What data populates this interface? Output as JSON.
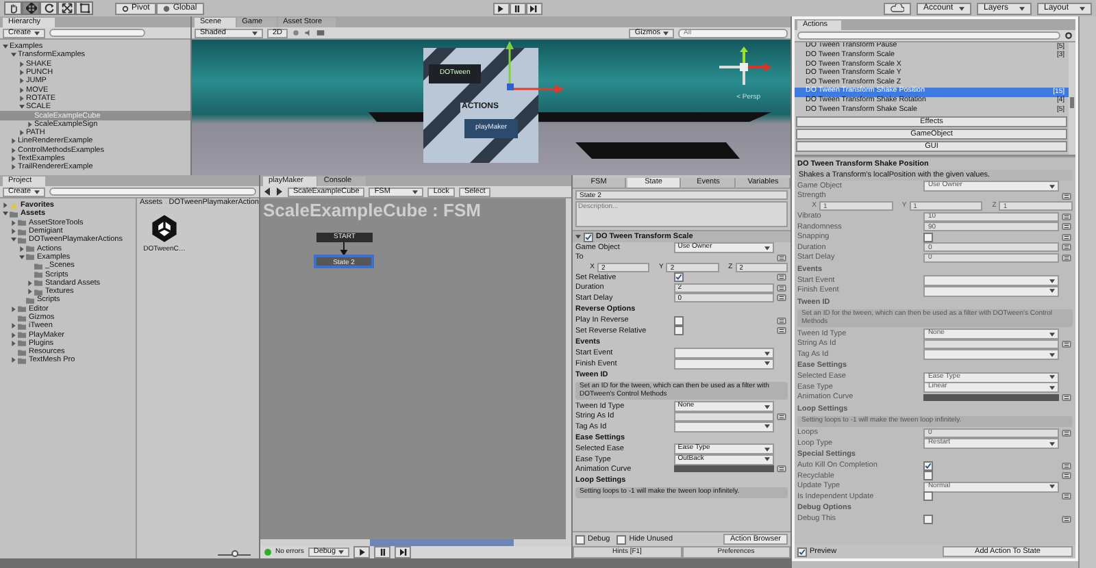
{
  "toolbar": {
    "tools": [
      {
        "kind": "hand",
        "selected": false
      },
      {
        "kind": "move",
        "selected": true
      },
      {
        "kind": "rotate",
        "selected": false
      },
      {
        "kind": "scale",
        "selected": false
      },
      {
        "kind": "rect",
        "selected": false
      }
    ],
    "pivot": "Pivot",
    "global": "Global",
    "account": "Account",
    "layers": "Layers",
    "layout": "Layout"
  },
  "hierarchy": {
    "tab": "Hierarchy",
    "create": "Create",
    "items": [
      {
        "label": "Examples",
        "expanded": true,
        "selected": false,
        "children": [
          {
            "label": "TransformExamples",
            "expanded": true,
            "selected": false,
            "children": [
              {
                "label": "SHAKE",
                "expanded": false,
                "selected": false
              },
              {
                "label": "PUNCH",
                "expanded": false,
                "selected": false
              },
              {
                "label": "JUMP",
                "expanded": false,
                "selected": false
              },
              {
                "label": "MOVE",
                "expanded": false,
                "selected": false
              },
              {
                "label": "ROTATE",
                "expanded": false,
                "selected": false
              },
              {
                "label": "SCALE",
                "expanded": true,
                "selected": false,
                "children": [
                  {
                    "label": "ScaleExampleCube",
                    "selected": true
                  },
                  {
                    "label": "ScaleExampleSign",
                    "expanded": false,
                    "selected": false
                  }
                ]
              },
              {
                "label": "PATH",
                "expanded": false,
                "selected": false
              }
            ]
          },
          {
            "label": "LineRendererExample",
            "expanded": false,
            "selected": false
          },
          {
            "label": "ControlMethodsExamples",
            "expanded": false,
            "selected": false
          },
          {
            "label": "TextExamples",
            "expanded": false,
            "selected": false
          },
          {
            "label": "TrailRendererExample",
            "expanded": false,
            "selected": false
          }
        ]
      }
    ]
  },
  "scene": {
    "tabs": [
      {
        "label": "Scene",
        "selected": true
      },
      {
        "label": "Game",
        "selected": false
      },
      {
        "label": "Asset Store",
        "selected": false
      }
    ],
    "shading": "Shaded",
    "mode_2d": "2D",
    "gizmos": "Gizmos",
    "search_placeholder": "All",
    "projection": "< Persp",
    "card": {
      "top_logo": "DOTween",
      "middle": "ACTIONS",
      "bottom_logo": "playMaker"
    }
  },
  "project": {
    "tab": "Project",
    "create": "Create",
    "items": [
      {
        "label": "Favorites",
        "kind": "favorites",
        "expanded": false,
        "selected": false
      },
      {
        "label": "Assets",
        "kind": "folder",
        "expanded": true,
        "selected": false,
        "children": [
          {
            "label": "AssetStoreTools",
            "expanded": false,
            "selected": false
          },
          {
            "label": "Demigiant",
            "expanded": false,
            "selected": false
          },
          {
            "label": "DOTweenPlaymakerActions",
            "expanded": true,
            "selected": false,
            "children": [
              {
                "label": "Actions",
                "expanded": false,
                "selected": false
              },
              {
                "label": "Examples",
                "expanded": true,
                "selected": false,
                "children": [
                  {
                    "label": "_Scenes",
                    "selected": false
                  },
                  {
                    "label": "Scripts",
                    "selected": false
                  },
                  {
                    "label": "Standard Assets",
                    "expanded": false,
                    "selected": false
                  },
                  {
                    "label": "Textures",
                    "expanded": false,
                    "selected": false
                  }
                ]
              },
              {
                "label": "Scripts",
                "selected": false
              }
            ]
          },
          {
            "label": "Editor",
            "expanded": false,
            "selected": false
          },
          {
            "label": "Gizmos",
            "selected": false
          },
          {
            "label": "iTween",
            "expanded": false,
            "selected": false
          },
          {
            "label": "PlayMaker",
            "expanded": false,
            "selected": false
          },
          {
            "label": "Plugins",
            "expanded": false,
            "selected": false
          },
          {
            "label": "Resources",
            "selected": false
          },
          {
            "label": "TextMesh Pro",
            "expanded": false,
            "selected": false
          }
        ]
      }
    ],
    "breadcrumb": [
      "Assets",
      "DOTweenPlaymakerAction"
    ],
    "assets": [
      "DOTweenC…"
    ],
    "zoom": {
      "level": 0.5
    }
  },
  "playmaker": {
    "tabs": [
      {
        "label": "playMaker",
        "selected": true
      },
      {
        "label": "Console",
        "selected": false
      }
    ],
    "object": "ScaleExampleCube",
    "fsm": "FSM",
    "lock": "Lock",
    "select": "Select",
    "title": "ScaleExampleCube : FSM",
    "start_label": "START",
    "states": [
      {
        "label": "State 2",
        "selected": true
      }
    ],
    "status": "No errors",
    "debug": "Debug"
  },
  "fsm_inspector": {
    "tabs": [
      {
        "label": "FSM",
        "selected": false
      },
      {
        "label": "State",
        "selected": true
      },
      {
        "label": "Events",
        "selected": false
      },
      {
        "label": "Variables",
        "selected": false
      }
    ],
    "state_name": "State 2",
    "description_placeholder": "Description...",
    "action": {
      "title": "DO Tween Transform Scale",
      "enabled": true
    },
    "rows": [
      {
        "kind": "dropdown",
        "label": "Game Object",
        "value": "Use Owner"
      },
      {
        "kind": "label",
        "label": "To"
      },
      {
        "kind": "vector",
        "axes": [
          {
            "axis": "X",
            "value": "2"
          },
          {
            "axis": "Y",
            "value": "2"
          },
          {
            "axis": "Z",
            "value": "2"
          }
        ]
      },
      {
        "kind": "checkbox",
        "label": "Set Relative",
        "checked": true
      },
      {
        "kind": "field",
        "label": "Duration",
        "value": "2"
      },
      {
        "kind": "field",
        "label": "Start Delay",
        "value": "0"
      },
      {
        "kind": "heading",
        "text": "Reverse Options"
      },
      {
        "kind": "checkbox",
        "label": "Play In Reverse",
        "checked": false
      },
      {
        "kind": "checkbox",
        "label": "Set Reverse Relative",
        "checked": false
      },
      {
        "kind": "heading",
        "text": "Events"
      },
      {
        "kind": "dropdown",
        "label": "Start Event"
      },
      {
        "kind": "dropdown",
        "label": "Finish Event"
      },
      {
        "kind": "heading",
        "text": "Tween ID"
      },
      {
        "kind": "note",
        "text": "Set an ID for the tween, which can then be used as a filter with DOTween's Control Methods"
      },
      {
        "kind": "dropdown",
        "label": "Tween Id Type",
        "value": "None"
      },
      {
        "kind": "field",
        "label": "String As Id"
      },
      {
        "kind": "dropdown",
        "label": "Tag As Id"
      },
      {
        "kind": "heading",
        "text": "Ease Settings"
      },
      {
        "kind": "dropdown",
        "label": "Selected Ease",
        "value": "Ease Type"
      },
      {
        "kind": "dropdown",
        "label": "Ease Type",
        "value": "OutBack"
      },
      {
        "kind": "curve",
        "label": "Animation Curve"
      },
      {
        "kind": "heading",
        "text": "Loop Settings"
      },
      {
        "kind": "note",
        "text": "Setting loops to -1 will make the tween loop infinitely."
      }
    ],
    "debug": {
      "label": "Debug",
      "checked": false
    },
    "hide_unused": {
      "label": "Hide Unused",
      "checked": false
    },
    "action_browser": "Action Browser",
    "hints": "Hints [F1]",
    "preferences": "Preferences"
  },
  "actions": {
    "tab": "Actions",
    "list": [
      {
        "label": "DO Tween Transform Pause",
        "count": "[5]",
        "selected": false
      },
      {
        "label": "DO Tween Transform Scale",
        "count": "[3]",
        "selected": false
      },
      {
        "label": "DO Tween Transform Scale X",
        "selected": false
      },
      {
        "label": "DO Tween Transform Scale Y",
        "selected": false
      },
      {
        "label": "DO Tween Transform Scale Z",
        "selected": false
      },
      {
        "label": "DO Tween Transform Shake Position",
        "count": "[15]",
        "selected": true
      },
      {
        "label": "DO Tween Transform Shake Rotation",
        "count": "[4]",
        "selected": false
      },
      {
        "label": "DO Tween Transform Shake Scale",
        "count": "[5]",
        "selected": false
      }
    ],
    "categories": [
      "Effects",
      "GameObject",
      "GUI"
    ],
    "preview": {
      "title": "DO Tween Transform Shake Position",
      "description": "Shakes a Transform's localPosition with the given values.",
      "disabled": true,
      "rows": [
        {
          "kind": "dropdown",
          "label": "Game Object",
          "value": "Use Owner"
        },
        {
          "kind": "label",
          "label": "Strength"
        },
        {
          "kind": "vector",
          "axes": [
            {
              "axis": "X",
              "value": "1"
            },
            {
              "axis": "Y",
              "value": "1"
            },
            {
              "axis": "Z",
              "value": "1"
            }
          ]
        },
        {
          "kind": "field",
          "label": "Vibrato",
          "value": "10"
        },
        {
          "kind": "field",
          "label": "Randomness",
          "value": "90"
        },
        {
          "kind": "checkbox",
          "label": "Snapping",
          "checked": false
        },
        {
          "kind": "field",
          "label": "Duration",
          "value": "0"
        },
        {
          "kind": "field",
          "label": "Start Delay",
          "value": "0"
        },
        {
          "kind": "heading",
          "text": "Events"
        },
        {
          "kind": "dropdown",
          "label": "Start Event"
        },
        {
          "kind": "dropdown",
          "label": "Finish Event"
        },
        {
          "kind": "heading",
          "text": "Tween ID"
        },
        {
          "kind": "note",
          "text": "Set an ID for the tween, which can then be used as a filter with DOTween's Control Methods"
        },
        {
          "kind": "dropdown",
          "label": "Tween Id Type",
          "value": "None"
        },
        {
          "kind": "field",
          "label": "String As Id"
        },
        {
          "kind": "dropdown",
          "label": "Tag As Id"
        },
        {
          "kind": "heading",
          "text": "Ease Settings"
        },
        {
          "kind": "dropdown",
          "label": "Selected Ease",
          "value": "Ease Type"
        },
        {
          "kind": "dropdown",
          "label": "Ease Type",
          "value": "Linear"
        },
        {
          "kind": "curve",
          "label": "Animation Curve"
        },
        {
          "kind": "heading",
          "text": "Loop Settings"
        },
        {
          "kind": "note",
          "text": "Setting loops to -1 will make the tween loop infinitely."
        },
        {
          "kind": "field",
          "label": "Loops",
          "value": "0"
        },
        {
          "kind": "dropdown",
          "label": "Loop Type",
          "value": "Restart"
        },
        {
          "kind": "heading",
          "text": "Special Settings"
        },
        {
          "kind": "checkbox",
          "label": "Auto Kill On Completion",
          "checked": true
        },
        {
          "kind": "checkbox",
          "label": "Recyclable",
          "checked": false
        },
        {
          "kind": "dropdown",
          "label": "Update Type",
          "value": "Normal"
        },
        {
          "kind": "checkbox",
          "label": "Is Independent Update",
          "checked": false
        },
        {
          "kind": "heading",
          "text": "Debug Options"
        },
        {
          "kind": "checkbox",
          "label": "Debug This",
          "checked": false
        }
      ]
    },
    "preview_toggle": {
      "label": "Preview",
      "checked": true
    },
    "add_button": "Add Action To State"
  }
}
